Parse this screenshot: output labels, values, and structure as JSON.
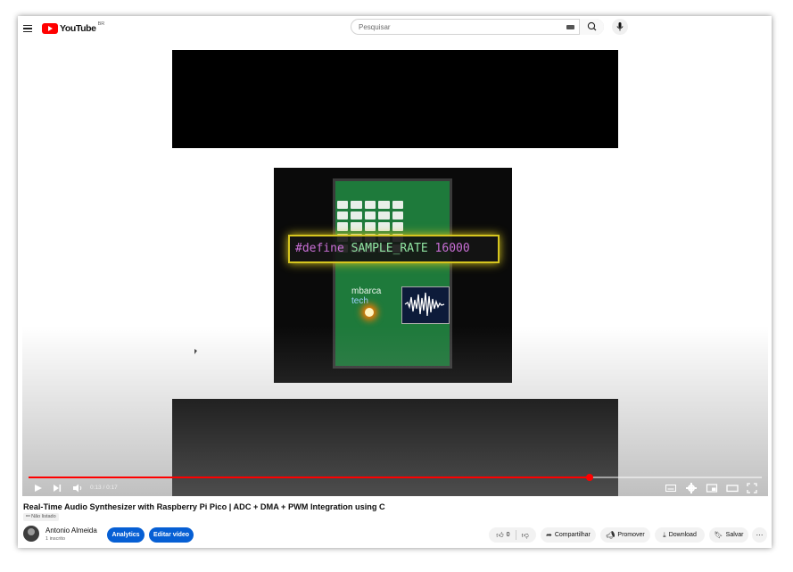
{
  "header": {
    "logo_text": "YouTube",
    "country_code": "BR",
    "search_placeholder": "Pesquisar"
  },
  "player": {
    "overlay_code": {
      "keyword": "#define",
      "identifier": "SAMPLE_RATE",
      "value": "16000"
    },
    "board_brand_line1": "mbarca",
    "board_brand_line2": "tech",
    "time_display": "0:13 / 0:17",
    "progress_fraction": 0.765,
    "progress_color": "#ff0000"
  },
  "video": {
    "title": "Real-Time Audio Synthesizer with Raspberry Pi Pico | ADC + DMA + PWM Integration using C",
    "visibility": "Não listado",
    "channel_name": "Antonio  Almeida",
    "subscribers": "1 inscrito"
  },
  "actions": {
    "analytics": "Analytics",
    "edit_video": "Editar vídeo",
    "likes": "0",
    "share": "Compartilhar",
    "promote": "Promover",
    "download": "Download",
    "save": "Salvar"
  },
  "colors": {
    "accent_blue": "#065fd4",
    "brand_red": "#ff0000"
  }
}
